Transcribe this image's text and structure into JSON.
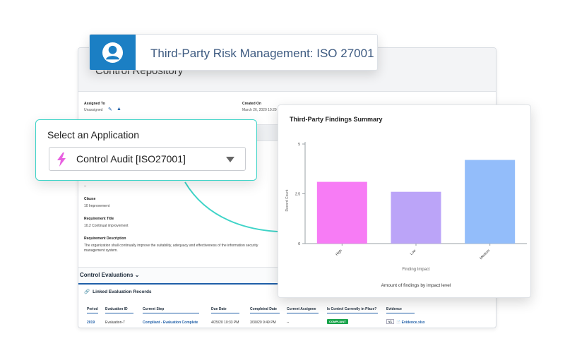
{
  "banner": {
    "title": "Third-Party Risk Management: ISO 27001",
    "icon": "user-avatar-icon",
    "color": "#1b7fc4"
  },
  "record": {
    "title": "Control Repository",
    "assigned_to_label": "Assigned To",
    "assigned_to_value": "Unassigned",
    "created_on_label": "Created On",
    "created_on_value": "March 26, 2020 10:29",
    "fields": [
      {
        "label": "SoD Requirement",
        "value": "--"
      },
      {
        "label": "Clause",
        "value": "10 Improvement"
      },
      {
        "label": "Requirement Title",
        "value": "10.2 Continual improvement"
      },
      {
        "label": "Requirement Description",
        "value": "The organization shall continually improve the suitability, adequacy and effectiveness of the information security management system."
      }
    ],
    "evaluations": {
      "section_title": "Control Evaluations",
      "linked_title": "Linked Evaluation Records",
      "columns": [
        "Period",
        "Evaluation ID",
        "Current Step",
        "Due Date",
        "Completed Date",
        "Current Assignee",
        "Is Control Currently in Place?",
        "Evidence"
      ],
      "row": {
        "period": "2019",
        "evaluation_id": "Evaluation-7",
        "current_step": "Compliant - Evaluation Complete",
        "due_date": "4/25/20 10:33 PM",
        "completed_date": "3/30/20 9:49 PM",
        "assignee": "--",
        "in_place": "COMPLIANT",
        "evidence_version": "v1",
        "evidence_file": "Evidence.xlsx"
      }
    }
  },
  "select": {
    "label": "Select an Application",
    "value": "Control Audit [ISO27001]",
    "icon": "lightning-bolt-icon",
    "accent": "#3fd4c8"
  },
  "chart_data": {
    "type": "bar",
    "title": "Third-Party Findings Summary",
    "categories": [
      "High",
      "Low",
      "Medium"
    ],
    "values": [
      3.1,
      2.6,
      4.2
    ],
    "colors": [
      "#f77cf5",
      "#bba4f8",
      "#93bdfa"
    ],
    "xlabel": "Finding Impact",
    "ylabel": "Record Count",
    "caption": "Amount of findings by impact level",
    "ylim": [
      0,
      5
    ],
    "yticks": [
      0,
      2.5,
      5
    ],
    "ytick_labels": [
      "0",
      "2.5",
      "5"
    ],
    "grid": false,
    "legend": "none"
  }
}
